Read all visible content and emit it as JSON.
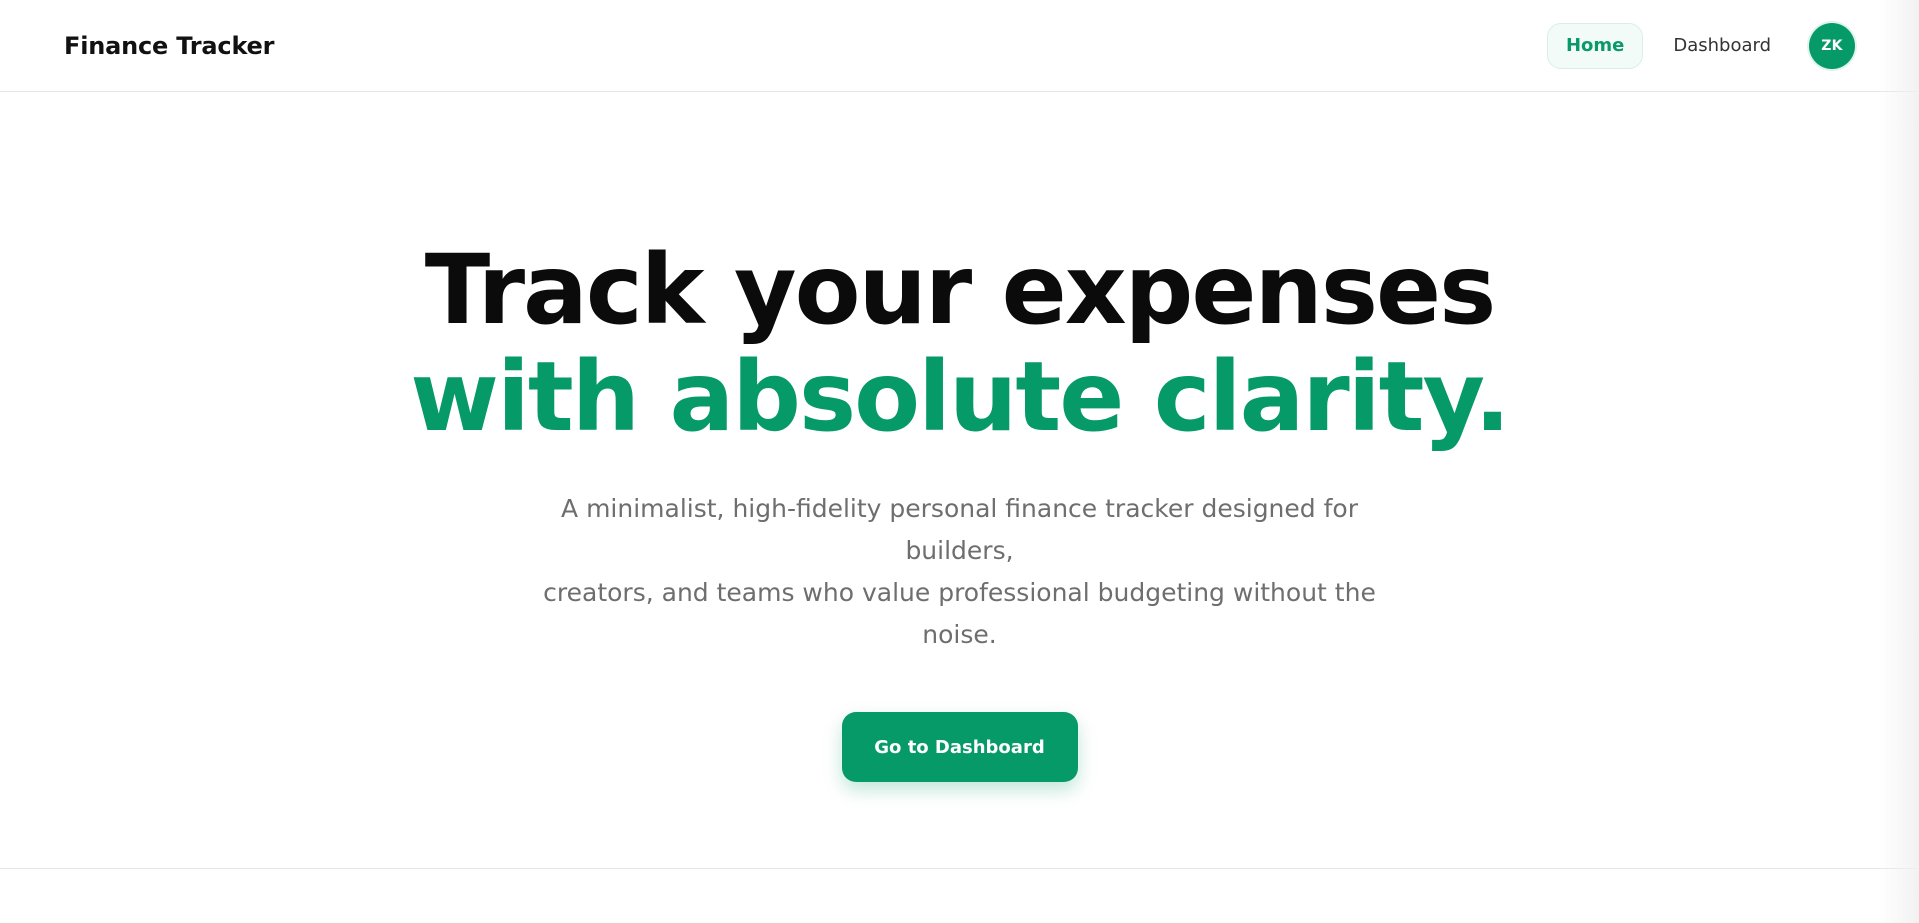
{
  "app": {
    "brand": "Finance Tracker"
  },
  "nav": {
    "home_label": "Home",
    "dashboard_label": "Dashboard",
    "avatar_initials": "ZK"
  },
  "hero": {
    "headline_line1": "Track your expenses",
    "headline_line2": "with absolute clarity.",
    "subtext_line1": "A minimalist, high-fidelity personal finance tracker designed for builders,",
    "subtext_line2": "creators, and teams who value professional budgeting without the noise.",
    "cta_label": "Go to Dashboard"
  },
  "colors": {
    "accent": "#069a68",
    "text_primary": "#0b0b0b",
    "text_muted": "#6e6e6e",
    "divider": "#e6e6e6"
  }
}
